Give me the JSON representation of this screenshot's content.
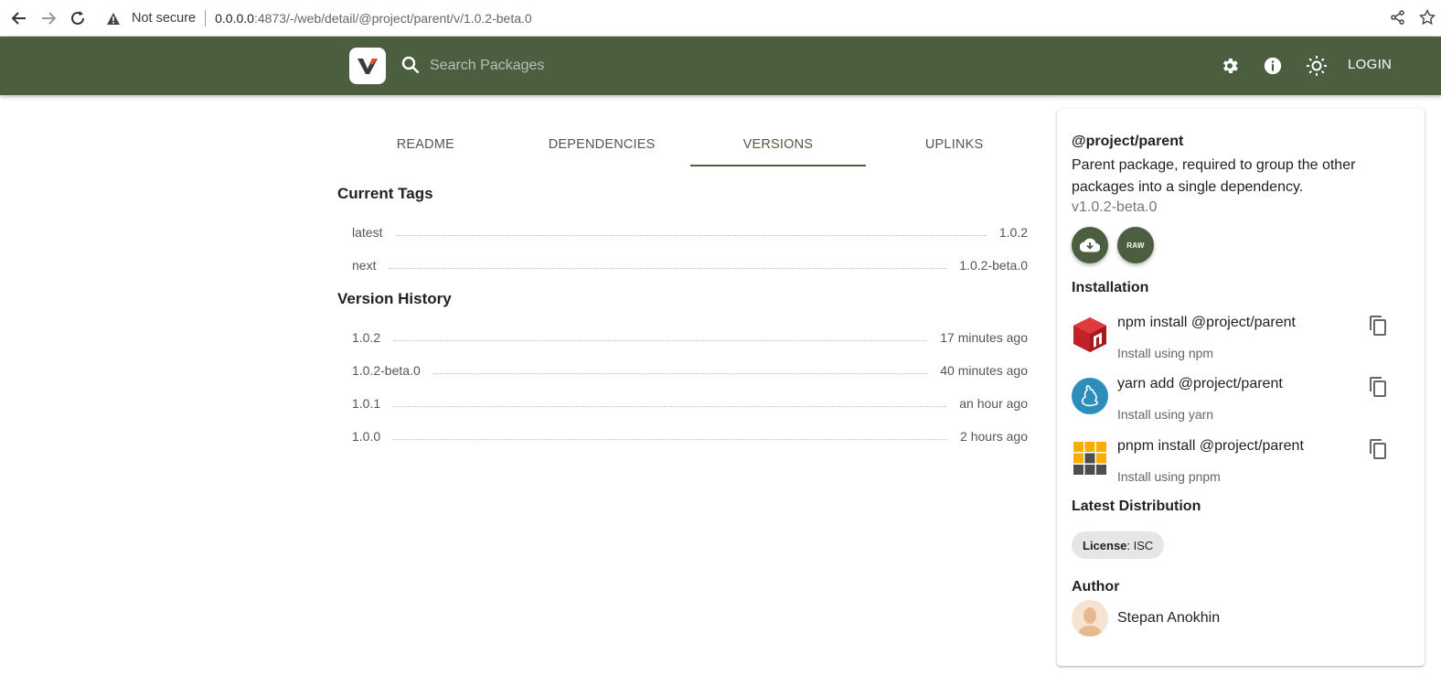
{
  "browser": {
    "security_label": "Not secure",
    "url_host": "0.0.0.0",
    "url_path": ":4873/-/web/detail/@project/parent/v/1.0.2-beta.0"
  },
  "header": {
    "search_placeholder": "Search Packages",
    "login_label": "LOGIN",
    "brand_color": "#4b5e40"
  },
  "tabs": [
    {
      "label": "README",
      "active": false
    },
    {
      "label": "DEPENDENCIES",
      "active": false
    },
    {
      "label": "VERSIONS",
      "active": true
    },
    {
      "label": "UPLINKS",
      "active": false
    }
  ],
  "current_tags": {
    "title": "Current Tags",
    "rows": [
      {
        "name": "latest",
        "value": "1.0.2"
      },
      {
        "name": "next",
        "value": "1.0.2-beta.0"
      }
    ]
  },
  "version_history": {
    "title": "Version History",
    "rows": [
      {
        "version": "1.0.2",
        "time": "17 minutes ago"
      },
      {
        "version": "1.0.2-beta.0",
        "time": "40 minutes ago"
      },
      {
        "version": "1.0.1",
        "time": "an hour ago"
      },
      {
        "version": "1.0.0",
        "time": "2 hours ago"
      }
    ]
  },
  "sidebar": {
    "package_name": "@project/parent",
    "description": "Parent package, required to group the other packages into a single dependency.",
    "version": "v1.0.2-beta.0",
    "raw_label": "RAW",
    "installation_title": "Installation",
    "installs": [
      {
        "command": "npm install @project/parent",
        "subtitle": "Install using npm",
        "icon": "npm-logo"
      },
      {
        "command": "yarn add @project/parent",
        "subtitle": "Install using yarn",
        "icon": "yarn-logo"
      },
      {
        "command": "pnpm install @project/parent",
        "subtitle": "Install using pnpm",
        "icon": "pnpm-logo"
      }
    ],
    "distribution_title": "Latest Distribution",
    "license_label": "License",
    "license_value": ": ISC",
    "author_title": "Author",
    "author_name": "Stepan Anokhin"
  }
}
